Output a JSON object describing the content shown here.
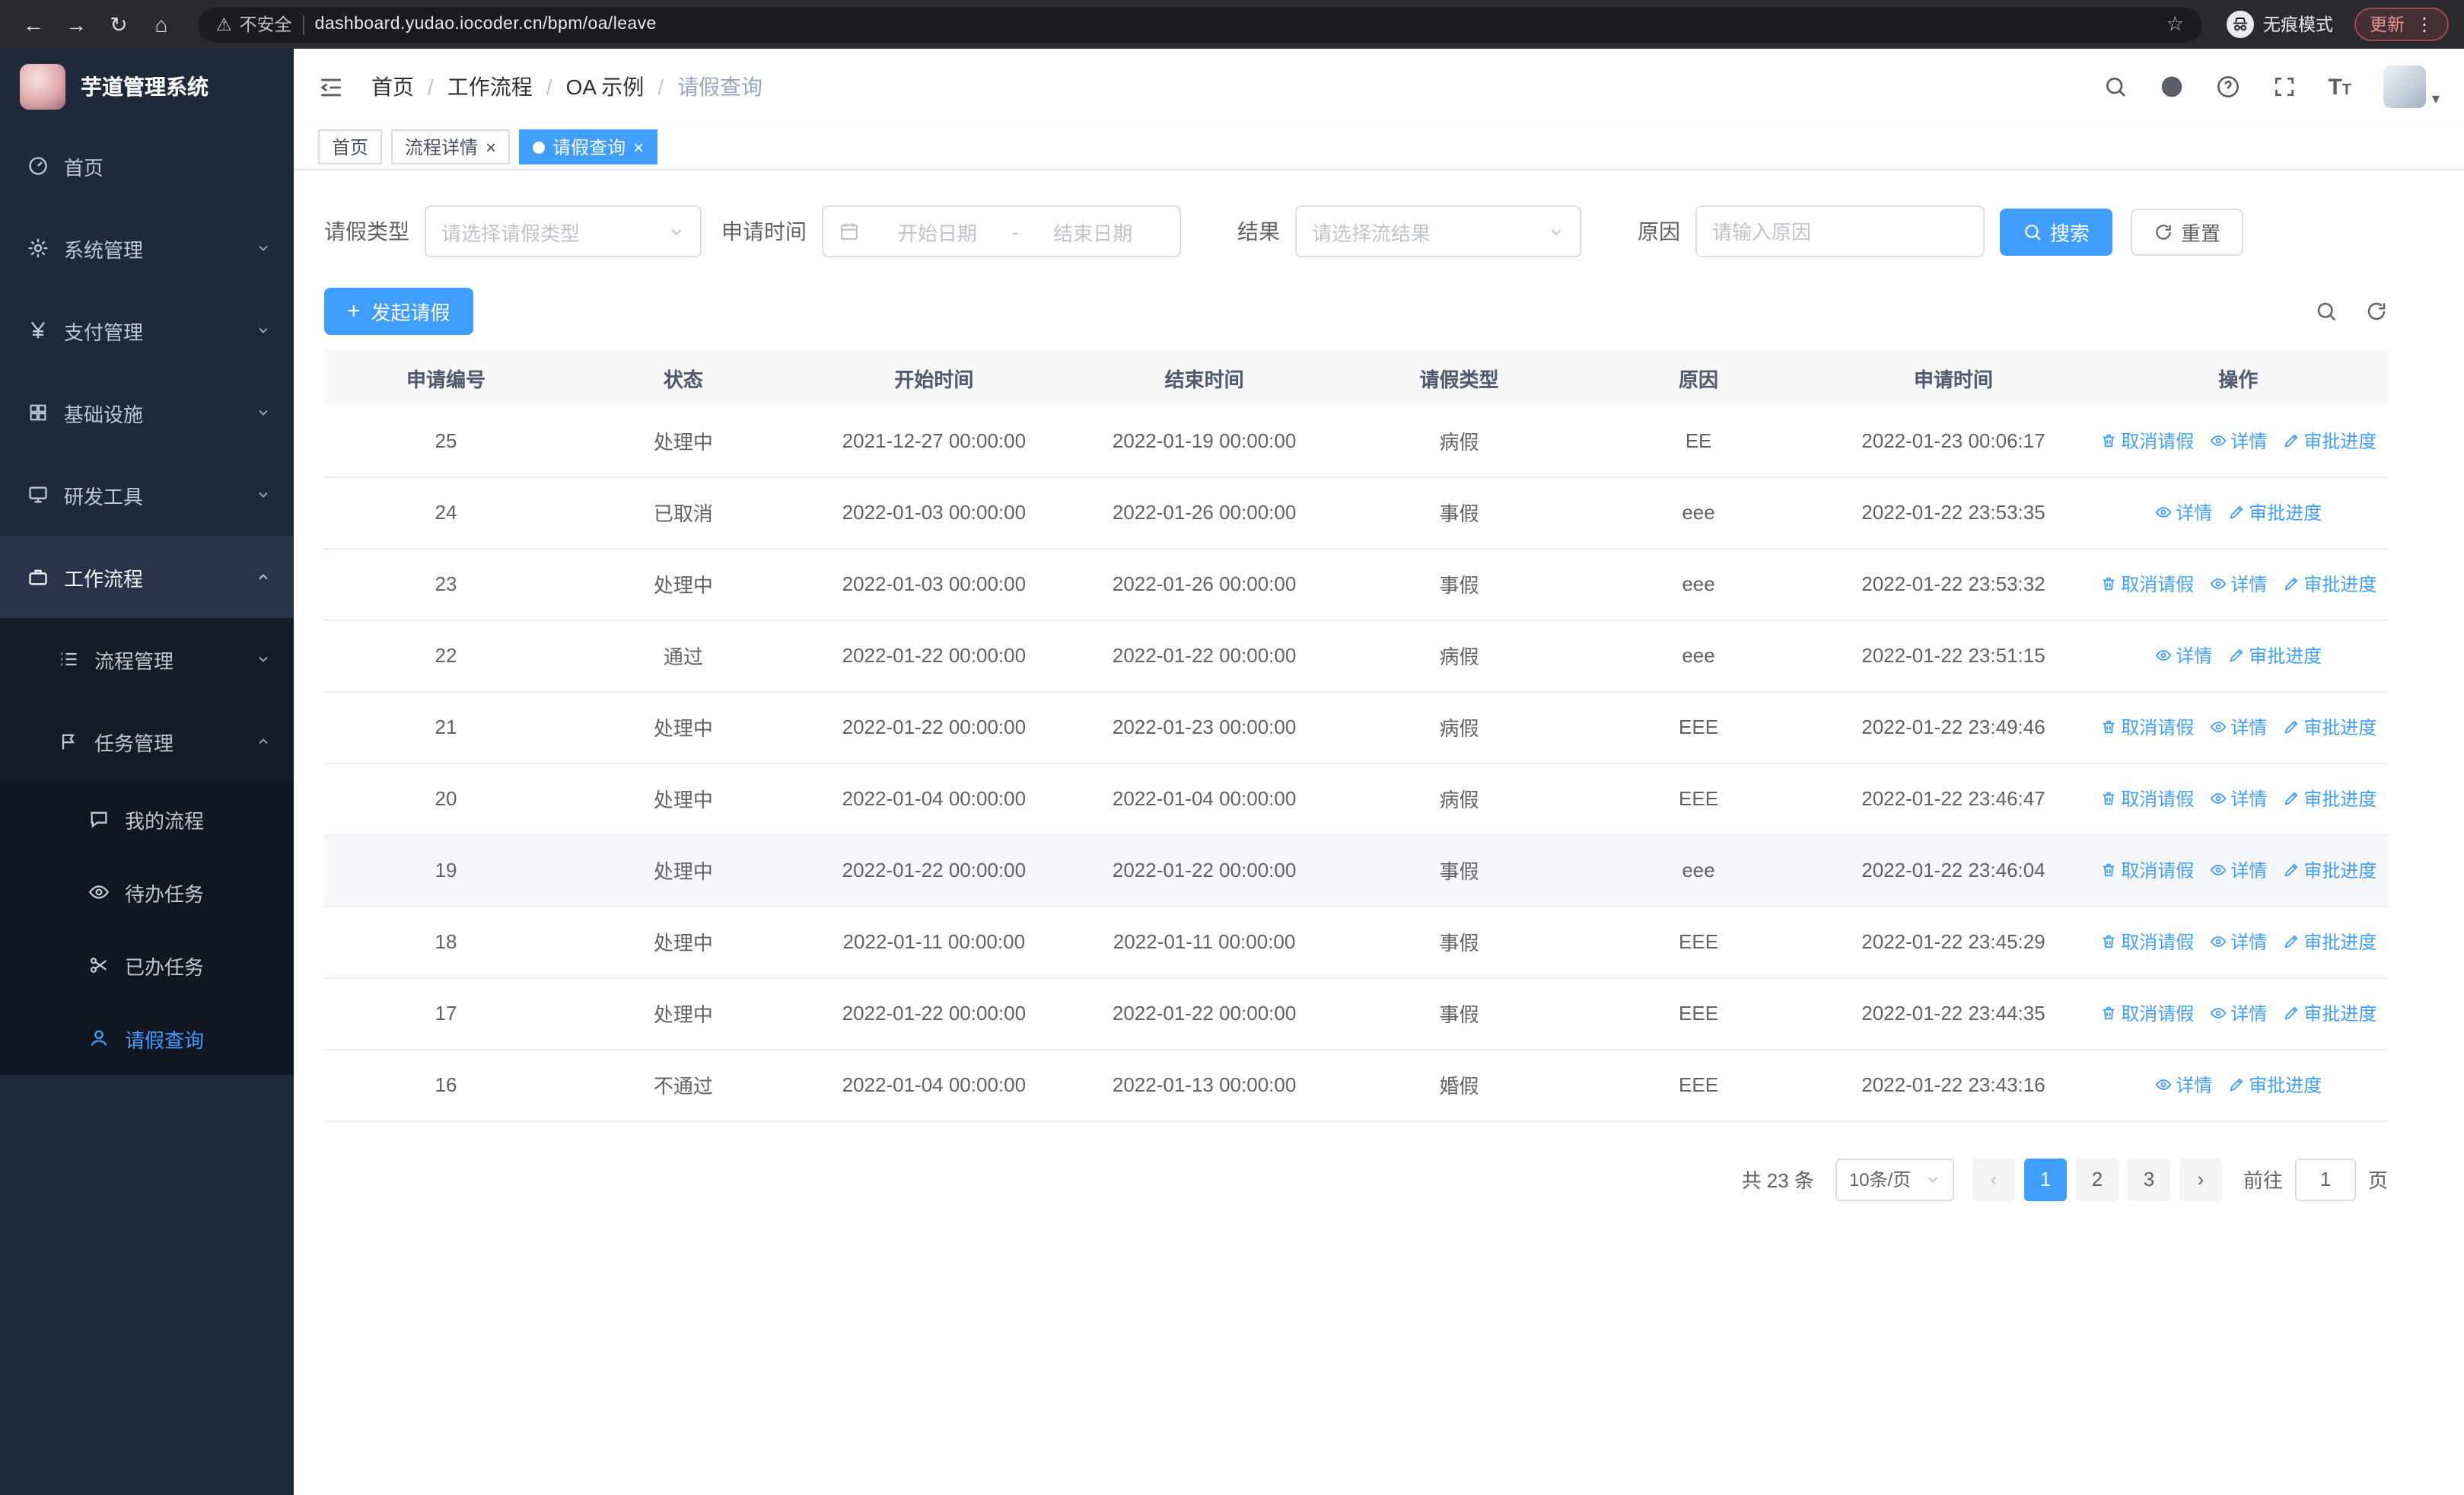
{
  "browser": {
    "url": "dashboard.yudao.iocoder.cn/bpm/oa/leave",
    "security_label": "不安全",
    "incognito_label": "无痕模式",
    "update_label": "更新"
  },
  "app_title": "芋道管理系统",
  "colors": {
    "accent": "#409eff",
    "sidebar_bg": "#1e2a3a",
    "sidebar_submenu_bg": "#141c28",
    "table_header_bg": "#f8f8f9",
    "update_pill_red": "#f0908a"
  },
  "sidebar": {
    "items": [
      {
        "key": "home",
        "label": "首页",
        "icon": "gauge-icon",
        "depth": 1
      },
      {
        "key": "system-mgmt",
        "label": "系统管理",
        "icon": "gear-icon",
        "depth": 1,
        "chevron": "down"
      },
      {
        "key": "payment-mgmt",
        "label": "支付管理",
        "icon": "yen-icon",
        "depth": 1,
        "chevron": "down"
      },
      {
        "key": "infrastructure",
        "label": "基础设施",
        "icon": "grid-icon",
        "depth": 1,
        "chevron": "down"
      },
      {
        "key": "dev-tools",
        "label": "研发工具",
        "icon": "monitor-icon",
        "depth": 1,
        "chevron": "down"
      },
      {
        "key": "workflow",
        "label": "工作流程",
        "icon": "briefcase-icon",
        "depth": 1,
        "chevron": "up",
        "open": true
      },
      {
        "key": "process-mgmt",
        "label": "流程管理",
        "icon": "list-icon",
        "depth": 2,
        "chevron": "down"
      },
      {
        "key": "task-mgmt",
        "label": "任务管理",
        "icon": "flag-icon",
        "depth": 2,
        "chevron": "up",
        "open": true
      },
      {
        "key": "my-process",
        "label": "我的流程",
        "icon": "chat-icon",
        "depth": 3
      },
      {
        "key": "todo-tasks",
        "label": "待办任务",
        "icon": "eye-icon",
        "depth": 3
      },
      {
        "key": "done-tasks",
        "label": "已办任务",
        "icon": "scissors-icon",
        "depth": 3
      },
      {
        "key": "leave-query",
        "label": "请假查询",
        "icon": "user-icon",
        "depth": 3,
        "active": true
      }
    ]
  },
  "breadcrumb": [
    "首页",
    "工作流程",
    "OA 示例",
    "请假查询"
  ],
  "tabs": [
    {
      "key": "home",
      "label": "首页",
      "closable": false,
      "active": false
    },
    {
      "key": "process-detail",
      "label": "流程详情",
      "closable": true,
      "active": false
    },
    {
      "key": "leave-query",
      "label": "请假查询",
      "closable": true,
      "active": true
    }
  ],
  "filters": {
    "leave_type": {
      "label": "请假类型",
      "placeholder": "请选择请假类型"
    },
    "apply_time": {
      "label": "申请时间",
      "start_placeholder": "开始日期",
      "separator": "-",
      "end_placeholder": "结束日期"
    },
    "result": {
      "label": "结果",
      "placeholder": "请选择流结果"
    },
    "reason": {
      "label": "原因",
      "placeholder": "请输入原因"
    },
    "search_label": "搜索",
    "reset_label": "重置"
  },
  "toolbar": {
    "create_label": "发起请假"
  },
  "table": {
    "columns": [
      "申请编号",
      "状态",
      "开始时间",
      "结束时间",
      "请假类型",
      "原因",
      "申请时间",
      "操作"
    ],
    "action_labels": {
      "cancel": "取消请假",
      "detail": "详情",
      "progress": "审批进度"
    },
    "rows": [
      {
        "id": "25",
        "status": "处理中",
        "start": "2021-12-27 00:00:00",
        "end": "2022-01-19 00:00:00",
        "type": "病假",
        "reason": "EE",
        "applied": "2022-01-23 00:06:17",
        "can_cancel": true
      },
      {
        "id": "24",
        "status": "已取消",
        "start": "2022-01-03 00:00:00",
        "end": "2022-01-26 00:00:00",
        "type": "事假",
        "reason": "eee",
        "applied": "2022-01-22 23:53:35",
        "can_cancel": false
      },
      {
        "id": "23",
        "status": "处理中",
        "start": "2022-01-03 00:00:00",
        "end": "2022-01-26 00:00:00",
        "type": "事假",
        "reason": "eee",
        "applied": "2022-01-22 23:53:32",
        "can_cancel": true
      },
      {
        "id": "22",
        "status": "通过",
        "start": "2022-01-22 00:00:00",
        "end": "2022-01-22 00:00:00",
        "type": "病假",
        "reason": "eee",
        "applied": "2022-01-22 23:51:15",
        "can_cancel": false
      },
      {
        "id": "21",
        "status": "处理中",
        "start": "2022-01-22 00:00:00",
        "end": "2022-01-23 00:00:00",
        "type": "病假",
        "reason": "EEE",
        "applied": "2022-01-22 23:49:46",
        "can_cancel": true
      },
      {
        "id": "20",
        "status": "处理中",
        "start": "2022-01-04 00:00:00",
        "end": "2022-01-04 00:00:00",
        "type": "病假",
        "reason": "EEE",
        "applied": "2022-01-22 23:46:47",
        "can_cancel": true
      },
      {
        "id": "19",
        "status": "处理中",
        "start": "2022-01-22 00:00:00",
        "end": "2022-01-22 00:00:00",
        "type": "事假",
        "reason": "eee",
        "applied": "2022-01-22 23:46:04",
        "can_cancel": true,
        "hover": true
      },
      {
        "id": "18",
        "status": "处理中",
        "start": "2022-01-11 00:00:00",
        "end": "2022-01-11 00:00:00",
        "type": "事假",
        "reason": "EEE",
        "applied": "2022-01-22 23:45:29",
        "can_cancel": true
      },
      {
        "id": "17",
        "status": "处理中",
        "start": "2022-01-22 00:00:00",
        "end": "2022-01-22 00:00:00",
        "type": "事假",
        "reason": "EEE",
        "applied": "2022-01-22 23:44:35",
        "can_cancel": true
      },
      {
        "id": "16",
        "status": "不通过",
        "start": "2022-01-04 00:00:00",
        "end": "2022-01-13 00:00:00",
        "type": "婚假",
        "reason": "EEE",
        "applied": "2022-01-22 23:43:16",
        "can_cancel": false
      }
    ]
  },
  "pagination": {
    "total_label": "共 23 条",
    "page_size": "10条/页",
    "pages": [
      "1",
      "2",
      "3"
    ],
    "current_page": "1",
    "goto_label": "前往",
    "goto_value": "1",
    "page_unit": "页"
  }
}
